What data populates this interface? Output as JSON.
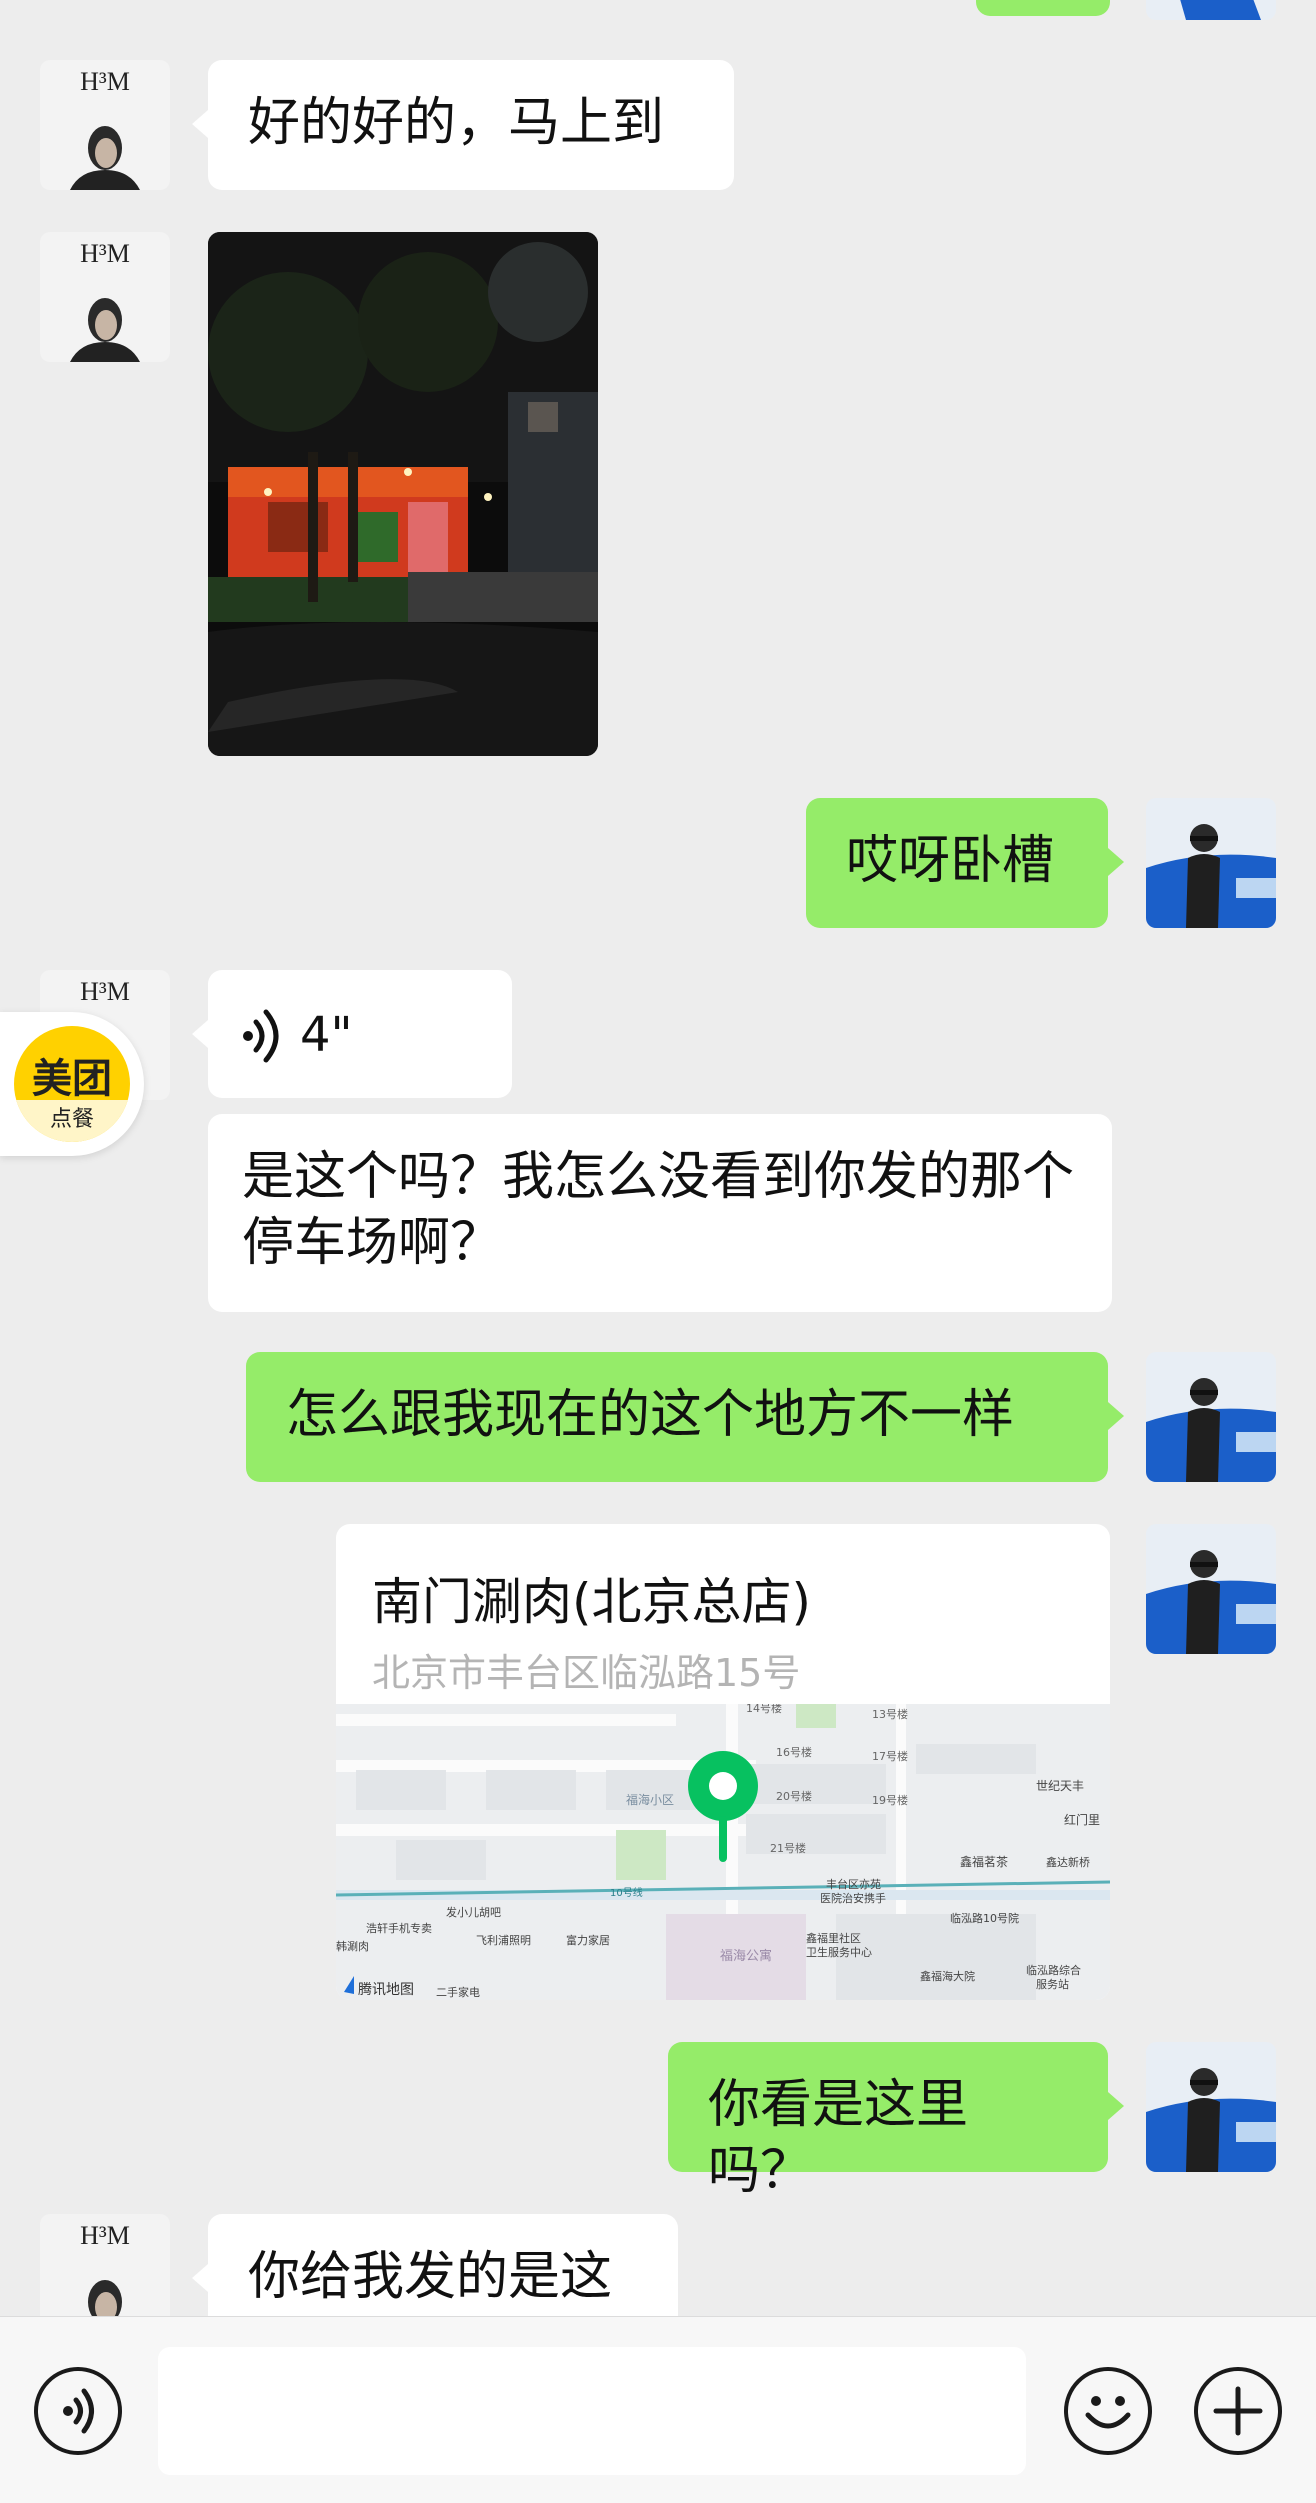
{
  "messages": {
    "m1": "好的好的，马上到",
    "m2": "哎呀卧槽",
    "voice_duration": "4\"",
    "m3": "是这个吗？我怎么没看到你发的那个停车场啊？",
    "m4": "怎么跟我现在的这个地方不一样",
    "m5": "你看是这里吗？",
    "m6": "你给我发的是这"
  },
  "location": {
    "name": "南门涮肉(北京总店)",
    "address": "北京市丰台区临泓路15号",
    "map_provider": "腾讯地图",
    "map_labels": {
      "l1": "14号楼",
      "l2": "13号楼",
      "l3": "16号楼",
      "l4": "17号楼",
      "l5": "20号楼",
      "l6": "19号楼",
      "l7": "21号楼",
      "l8": "福海小区",
      "l9": "世纪天丰",
      "l10": "红门里",
      "l11": "鑫福茗茶",
      "l12": "丰台区亦苑",
      "l13": "医院治安携手",
      "l14": "临泓路10号院",
      "l15": "鑫福里社区",
      "l16": "卫生服务中心",
      "l17": "福海公寓",
      "l18": "鑫福海大院",
      "l19": "发小儿胡吧",
      "l20": "浩轩手机专卖",
      "l21": "飞利浦照明",
      "l22": "富力家居",
      "l23": "韩涮肉",
      "l24": "二手家电",
      "l25": "10号线",
      "l26": "临泓路综合",
      "l27": "服务站",
      "l28": "鑫达新桥"
    }
  },
  "meituan": {
    "brand": "美团",
    "sub": "点餐"
  },
  "input": {
    "placeholder": ""
  },
  "colors": {
    "outgoing": "#95ec69",
    "incoming": "#ffffff",
    "background": "#ededed",
    "pin": "#07c160"
  }
}
